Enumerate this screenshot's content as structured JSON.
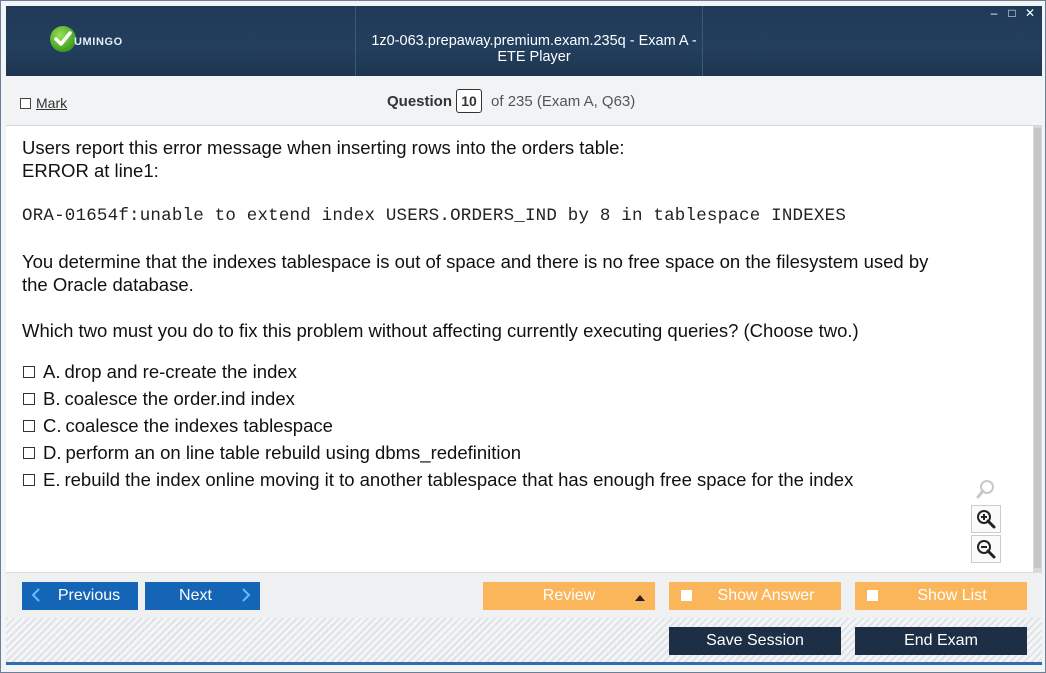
{
  "window": {
    "title": "1z0-063.prepaway.premium.exam.235q - Exam A - ETE Player",
    "logo_text": "UMINGO",
    "controls": [
      "–",
      "□",
      "✕"
    ]
  },
  "header": {
    "mark_label": "Mark",
    "question_label": "Question",
    "question_number": "10",
    "question_of": "of 235 (Exam A, Q63)"
  },
  "question": {
    "line1": "Users report this error message when inserting rows into the orders table:",
    "line2": "ERROR at line1:",
    "error_code": "ORA-01654f:unable to extend index USERS.ORDERS_IND by 8 in tablespace INDEXES",
    "para1_line1": "You determine that the indexes tablespace is out of space and there is no free space on the filesystem used by",
    "para1_line2": "the Oracle database.",
    "prompt": "Which two must you do to fix this problem without affecting currently executing queries? (Choose two.)"
  },
  "answers": [
    {
      "letter": "A.",
      "text": "drop and re-create the index"
    },
    {
      "letter": "B.",
      "text": "coalesce the order.ind index"
    },
    {
      "letter": "C.",
      "text": "coalesce the indexes tablespace"
    },
    {
      "letter": "D.",
      "text": "perform an on line table rebuild using dbms_redefinition"
    },
    {
      "letter": "E.",
      "text": "rebuild the index online moving it to another tablespace that has enough free space for the index"
    }
  ],
  "nav": {
    "previous": "Previous",
    "next": "Next",
    "review": "Review",
    "show_answer": "Show Answer",
    "show_list": "Show List"
  },
  "footer": {
    "save_session": "Save Session",
    "end_exam": "End Exam"
  },
  "colors": {
    "titlebar": "#223d5b",
    "nav_blue": "#1565b6",
    "nav_orange": "#fbb55a",
    "footer_dark": "#1c2f45"
  }
}
